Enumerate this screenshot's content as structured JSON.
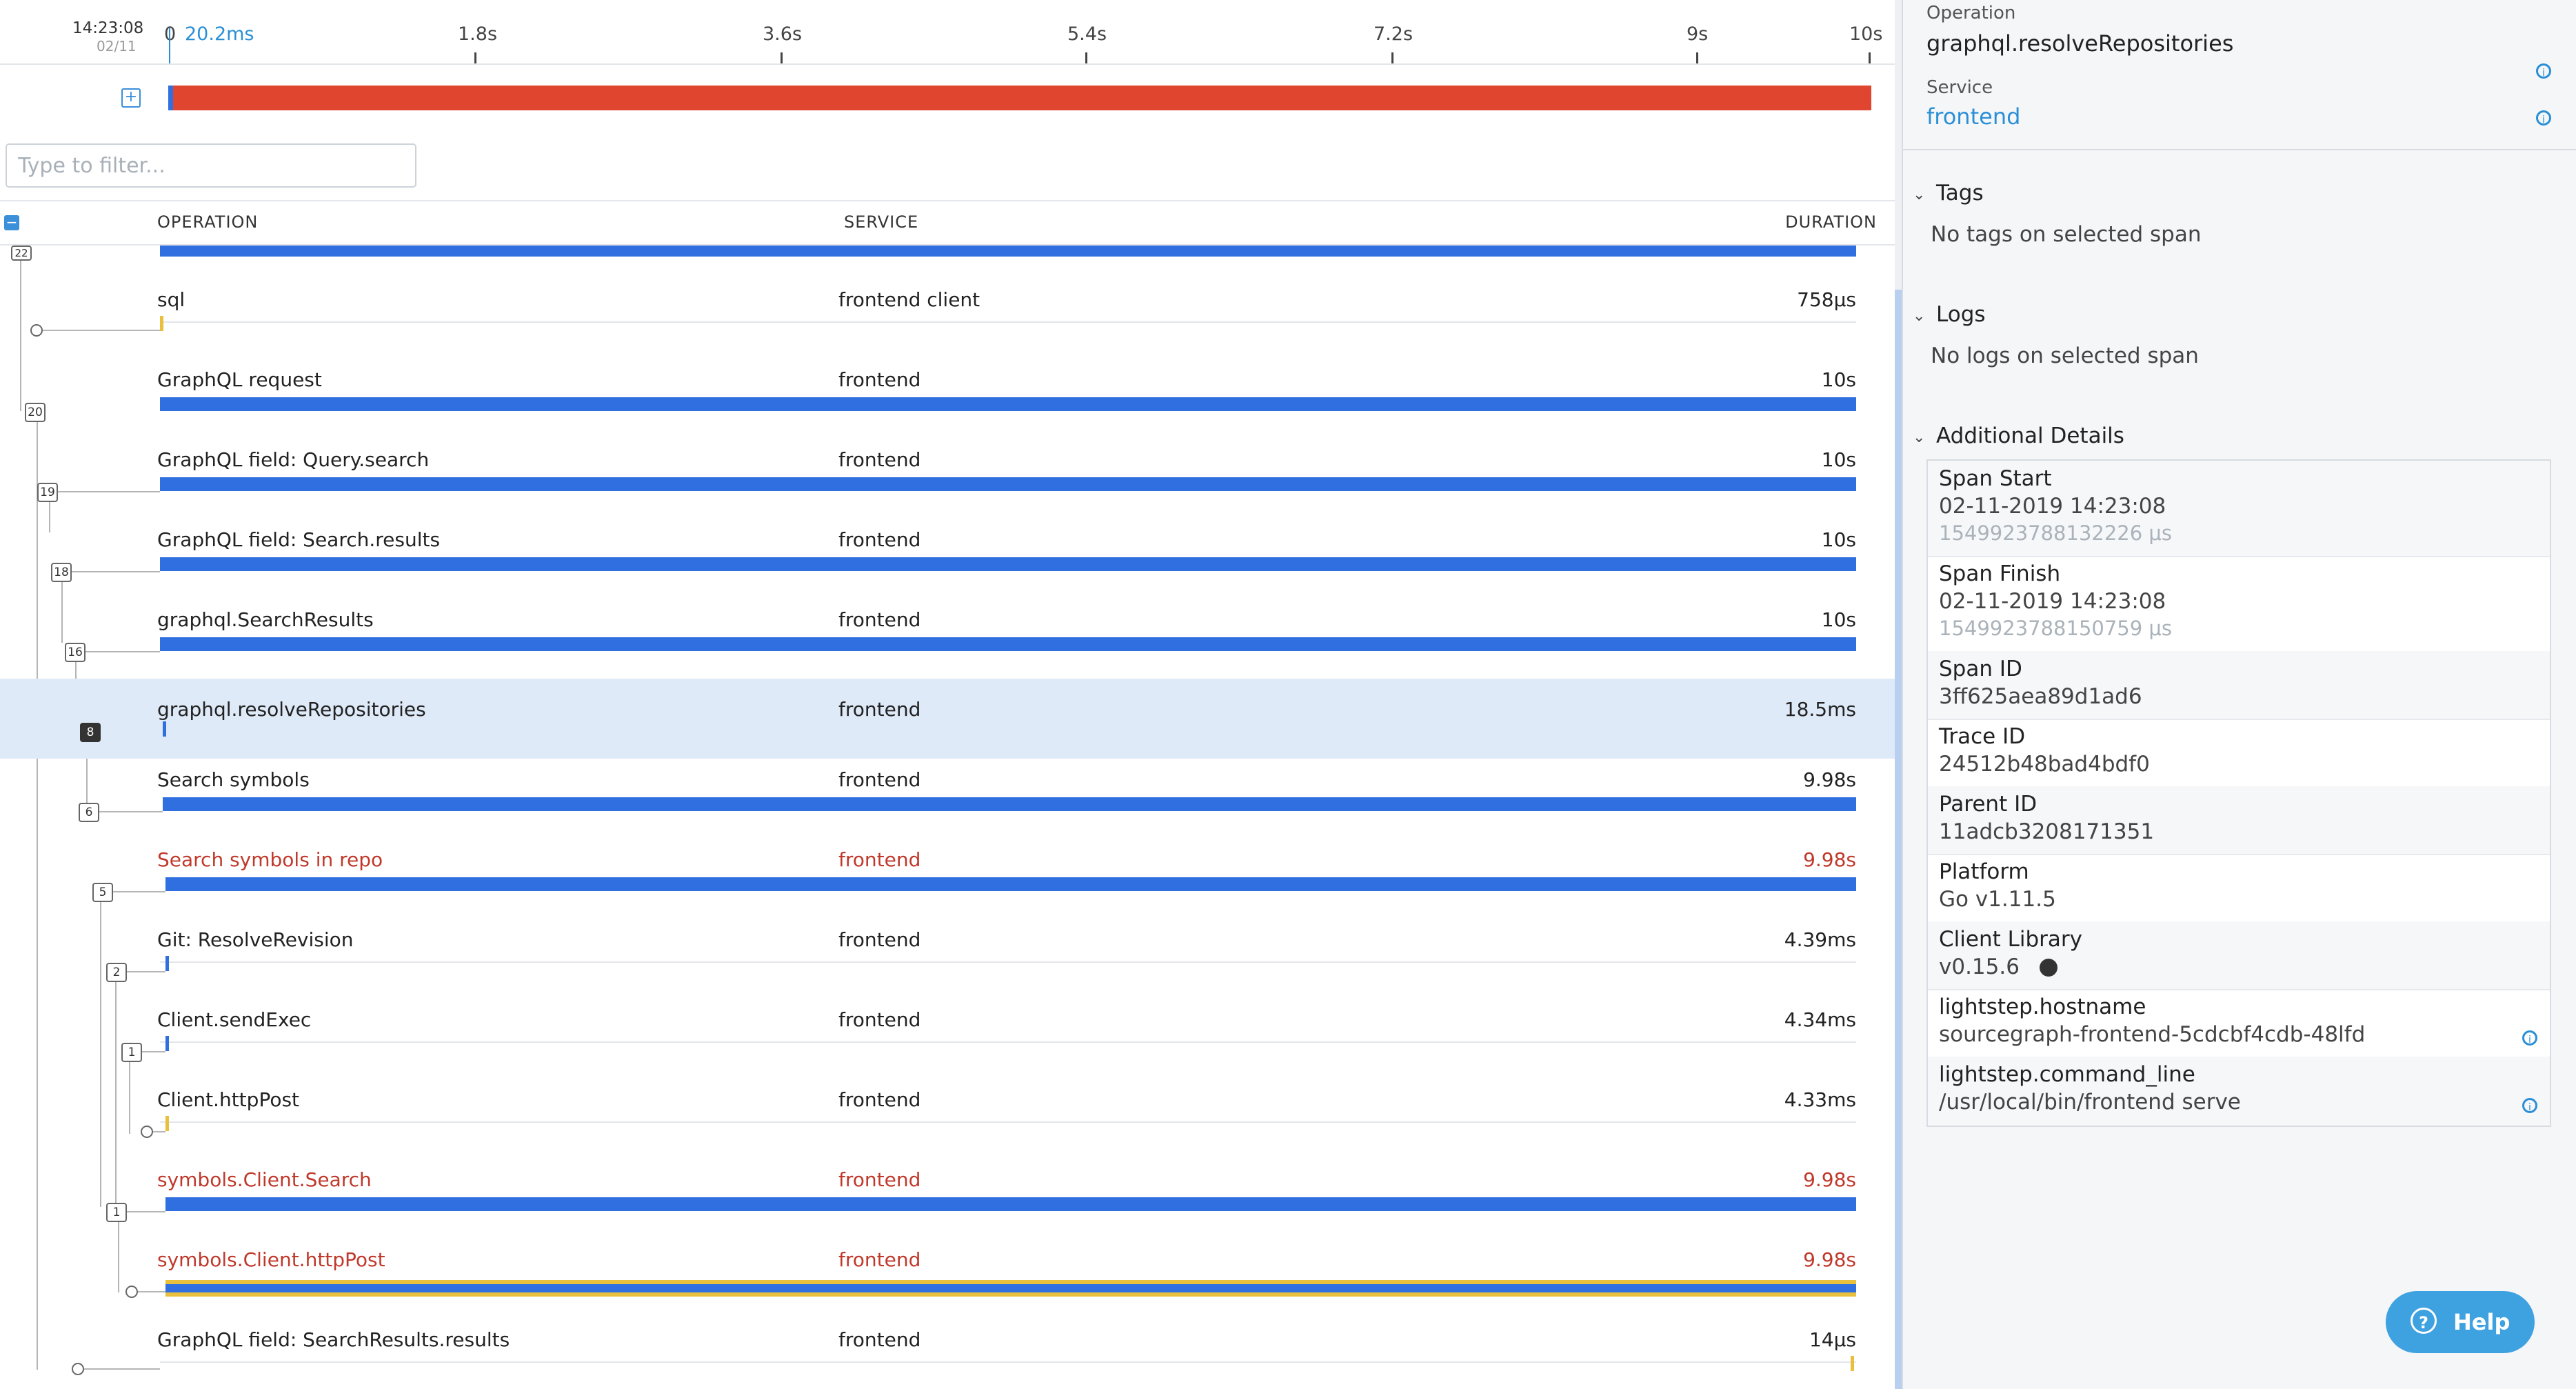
{
  "timeline": {
    "time": "14:23:08",
    "date": "02/11",
    "cursor_value": "20.2ms",
    "ticks": [
      "0",
      "1.8s",
      "3.6s",
      "5.4s",
      "7.2s",
      "9s",
      "10s"
    ]
  },
  "filter": {
    "placeholder": "Type to filter..."
  },
  "columns": {
    "operation": "OPERATION",
    "service": "SERVICE",
    "duration": "DURATION"
  },
  "rows": [
    {
      "node": "22"
    },
    {
      "operation": "sql",
      "service": "frontend client",
      "duration": "758μs"
    },
    {
      "operation": "GraphQL request",
      "service": "frontend",
      "duration": "10s",
      "node": "20"
    },
    {
      "operation": "GraphQL field: Query.search",
      "service": "frontend",
      "duration": "10s",
      "node": "19"
    },
    {
      "operation": "GraphQL field: Search.results",
      "service": "frontend",
      "duration": "10s",
      "node": "18"
    },
    {
      "operation": "graphql.SearchResults",
      "service": "frontend",
      "duration": "10s",
      "node": "16"
    },
    {
      "operation": "graphql.resolveRepositories",
      "service": "frontend",
      "duration": "18.5ms",
      "node": "8",
      "selected": true
    },
    {
      "operation": "Search symbols",
      "service": "frontend",
      "duration": "9.98s",
      "node": "6"
    },
    {
      "operation": "Search symbols in repo",
      "service": "frontend",
      "duration": "9.98s",
      "node": "5",
      "error": true
    },
    {
      "operation": "Git: ResolveRevision",
      "service": "frontend",
      "duration": "4.39ms",
      "node": "2"
    },
    {
      "operation": "Client.sendExec",
      "service": "frontend",
      "duration": "4.34ms",
      "node": "1"
    },
    {
      "operation": "Client.httpPost",
      "service": "frontend",
      "duration": "4.33ms"
    },
    {
      "operation": "symbols.Client.Search",
      "service": "frontend",
      "duration": "9.98s",
      "node": "1",
      "error": true
    },
    {
      "operation": "symbols.Client.httpPost",
      "service": "frontend",
      "duration": "9.98s",
      "error": true
    },
    {
      "operation": "GraphQL field: SearchResults.results",
      "service": "frontend",
      "duration": "14μs"
    }
  ],
  "panel": {
    "operation_label": "Operation",
    "operation_value": "graphql.resolveRepositories",
    "service_label": "Service",
    "service_value": "frontend",
    "tags_title": "Tags",
    "tags_empty": "No tags on selected span",
    "logs_title": "Logs",
    "logs_empty": "No logs on selected span",
    "details_title": "Additional Details",
    "details": [
      {
        "key": "Span Start",
        "value": "02-11-2019 14:23:08",
        "sub": "1549923788132226 μs"
      },
      {
        "key": "Span Finish",
        "value": "02-11-2019 14:23:08",
        "sub": "1549923788150759 μs"
      },
      {
        "key": "Span ID",
        "value": "3ff625aea89d1ad6"
      },
      {
        "key": "Trace ID",
        "value": "24512b48bad4bdf0"
      },
      {
        "key": "Parent ID",
        "value": "11adcb3208171351"
      },
      {
        "key": "Platform",
        "value": "Go v1.11.5"
      },
      {
        "key": "Client Library",
        "value": "v0.15.6"
      },
      {
        "key": "lightstep.hostname",
        "value": "sourcegraph-frontend-5cdcbf4cdb-48lfd"
      },
      {
        "key": "lightstep.command_line",
        "value": "/usr/local/bin/frontend serve"
      }
    ]
  },
  "help": {
    "label": "Help"
  },
  "colors": {
    "accent": "#2b8fd6",
    "bar": "#2f6fe0",
    "overview": "#e0452f",
    "error_text": "#c0392b",
    "selected_row": "#dfeaf8"
  }
}
